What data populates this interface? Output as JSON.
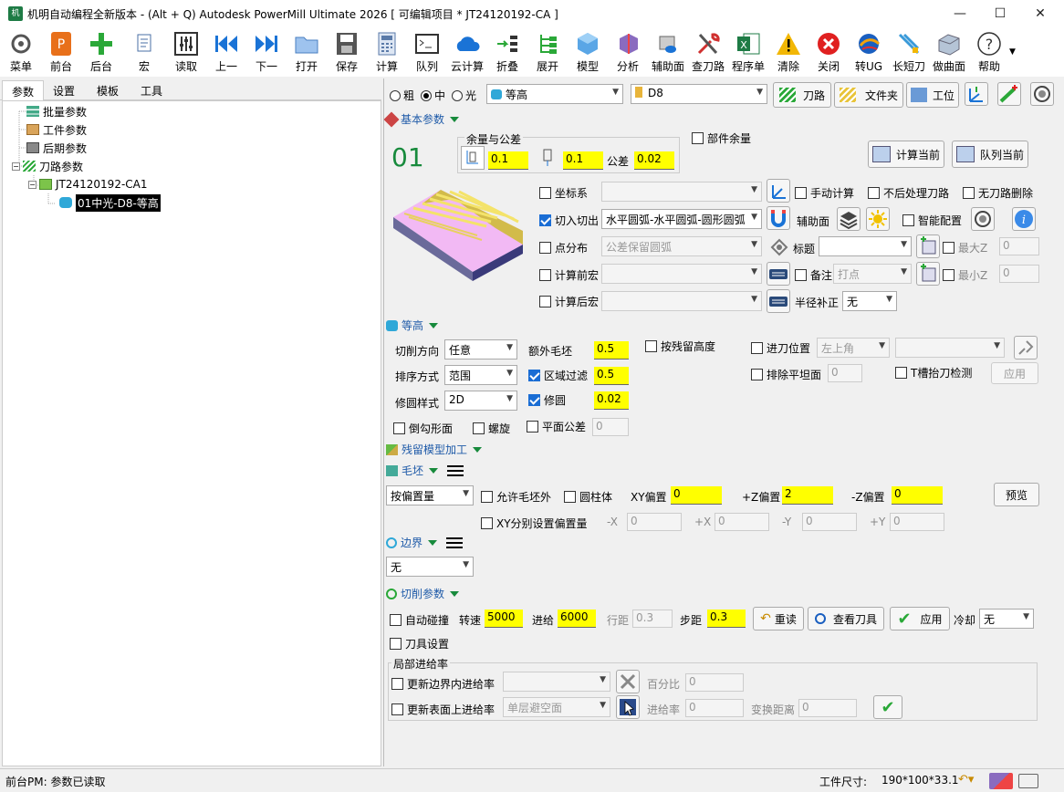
{
  "app": {
    "title": "机明自动编程全新版本 - (Alt + Q) Autodesk PowerMill Ultimate 2026    [ 可编辑项目 * JT24120192-CA ]",
    "icon": "app-icon"
  },
  "window_controls": {
    "minimize": "—",
    "maximize": "☐",
    "close": "✕"
  },
  "toolbar": [
    "菜单",
    "前台",
    "后台",
    "宏",
    "读取",
    "上一",
    "下一",
    "打开",
    "保存",
    "计算",
    "队列",
    "云计算",
    "折叠",
    "展开",
    "模型",
    "分析",
    "辅助面",
    "查刀路",
    "程序单",
    "清除",
    "关闭",
    "转UG",
    "长短刀",
    "做曲面",
    "帮助"
  ],
  "left_tabs": [
    "参数",
    "设置",
    "模板",
    "工具"
  ],
  "tree": {
    "batch": "批量参数",
    "workpiece": "工件参数",
    "post": "后期参数",
    "toolpath": "刀路参数",
    "project": "JT24120192-CA1",
    "item": "01中光-D8-等高"
  },
  "top": {
    "r1": "粗",
    "r2": "中",
    "r3": "光",
    "strategy": "等高",
    "tool": "D8",
    "btn_toolpath": "刀路",
    "btn_folder": "文件夹",
    "btn_station": "工位"
  },
  "basic": {
    "section": "基本参数",
    "number": "01",
    "allowance_group": "余量与公差",
    "allow1": "0.1",
    "allow2": "0.1",
    "tol_label": "公差",
    "tol": "0.02",
    "part_allowance": "部件余量",
    "calc_current": "计算当前",
    "queue_current": "队列当前"
  },
  "opts": {
    "coord": "坐标系",
    "manual": "手动计算",
    "noproc": "不后处理刀路",
    "nodel": "无刀路删除",
    "leadin": "切入切出",
    "leadin_val": "水平圆弧-水平圆弧-圆形圆弧",
    "aux": "辅助面",
    "smart": "智能配置",
    "pointdist": "点分布",
    "pointdist_val": "公差保留圆弧",
    "title_lbl": "标题",
    "maxz": "最大Z",
    "maxz_val": "0",
    "premacro": "计算前宏",
    "note": "备注",
    "note_val": "打点",
    "minz": "最小Z",
    "minz_val": "0",
    "postmacro": "计算后宏",
    "radcomp": "半径补正",
    "radcomp_val": "无"
  },
  "contour": {
    "section": "等高",
    "cutdir": "切削方向",
    "cutdir_val": "任意",
    "extra": "额外毛坯",
    "extra_val": "0.5",
    "byresidual": "按残留高度",
    "leadpos": "进刀位置",
    "leadpos_val": "左上角",
    "order": "排序方式",
    "order_val": "范围",
    "areafilter": "区域过滤",
    "areafilter_val": "0.5",
    "exclflat": "排除平坦面",
    "exclflat_val": "0",
    "tslot": "T槽抬刀检测",
    "apply": "应用",
    "roundstyle": "修圆样式",
    "roundstyle_val": "2D",
    "round": "修圆",
    "round_val": "0.02",
    "chamfer": "倒勾形面",
    "spiral": "螺旋",
    "flattol": "平面公差",
    "flattol_val": "0"
  },
  "rest": {
    "section": "残留模型加工"
  },
  "stock": {
    "section": "毛坯",
    "mode": "按偏置量",
    "allowout": "允许毛坯外",
    "cylinder": "圆柱体",
    "xy": "XY偏置",
    "xy_val": "0",
    "pz": "+Z偏置",
    "pz_val": "2",
    "mz": "-Z偏置",
    "mz_val": "0",
    "preview": "预览",
    "xysep": "XY分别设置偏置量",
    "nx": "-X",
    "nx_val": "0",
    "px": "+X",
    "px_val": "0",
    "ny": "-Y",
    "ny_val": "0",
    "py": "+Y",
    "py_val": "0"
  },
  "boundary": {
    "section": "边界",
    "val": "无"
  },
  "cut": {
    "section": "切削参数",
    "autocol": "自动碰撞",
    "speed": "转速",
    "speed_val": "5000",
    "feed": "进给",
    "feed_val": "6000",
    "rowdist": "行距",
    "rowdist_val": "0.3",
    "step": "步距",
    "step_val": "0.3",
    "reread": "重读",
    "viewtool": "查看刀具",
    "apply": "应用",
    "coolant": "冷却",
    "coolant_val": "无",
    "toolset": "刀具设置"
  },
  "local": {
    "title": "局部进给率",
    "bound": "更新边界内进给率",
    "percent": "百分比",
    "percent_val": "0",
    "surf": "更新表面上进给率",
    "surf_val": "单层避空面",
    "feedrate": "进给率",
    "feedrate_val": "0",
    "switchdist": "变换距离",
    "switchdist_val": "0"
  },
  "status": {
    "left": "前台PM: 参数已读取",
    "size_label": "工件尺寸:",
    "size": "190*100*33.1"
  }
}
